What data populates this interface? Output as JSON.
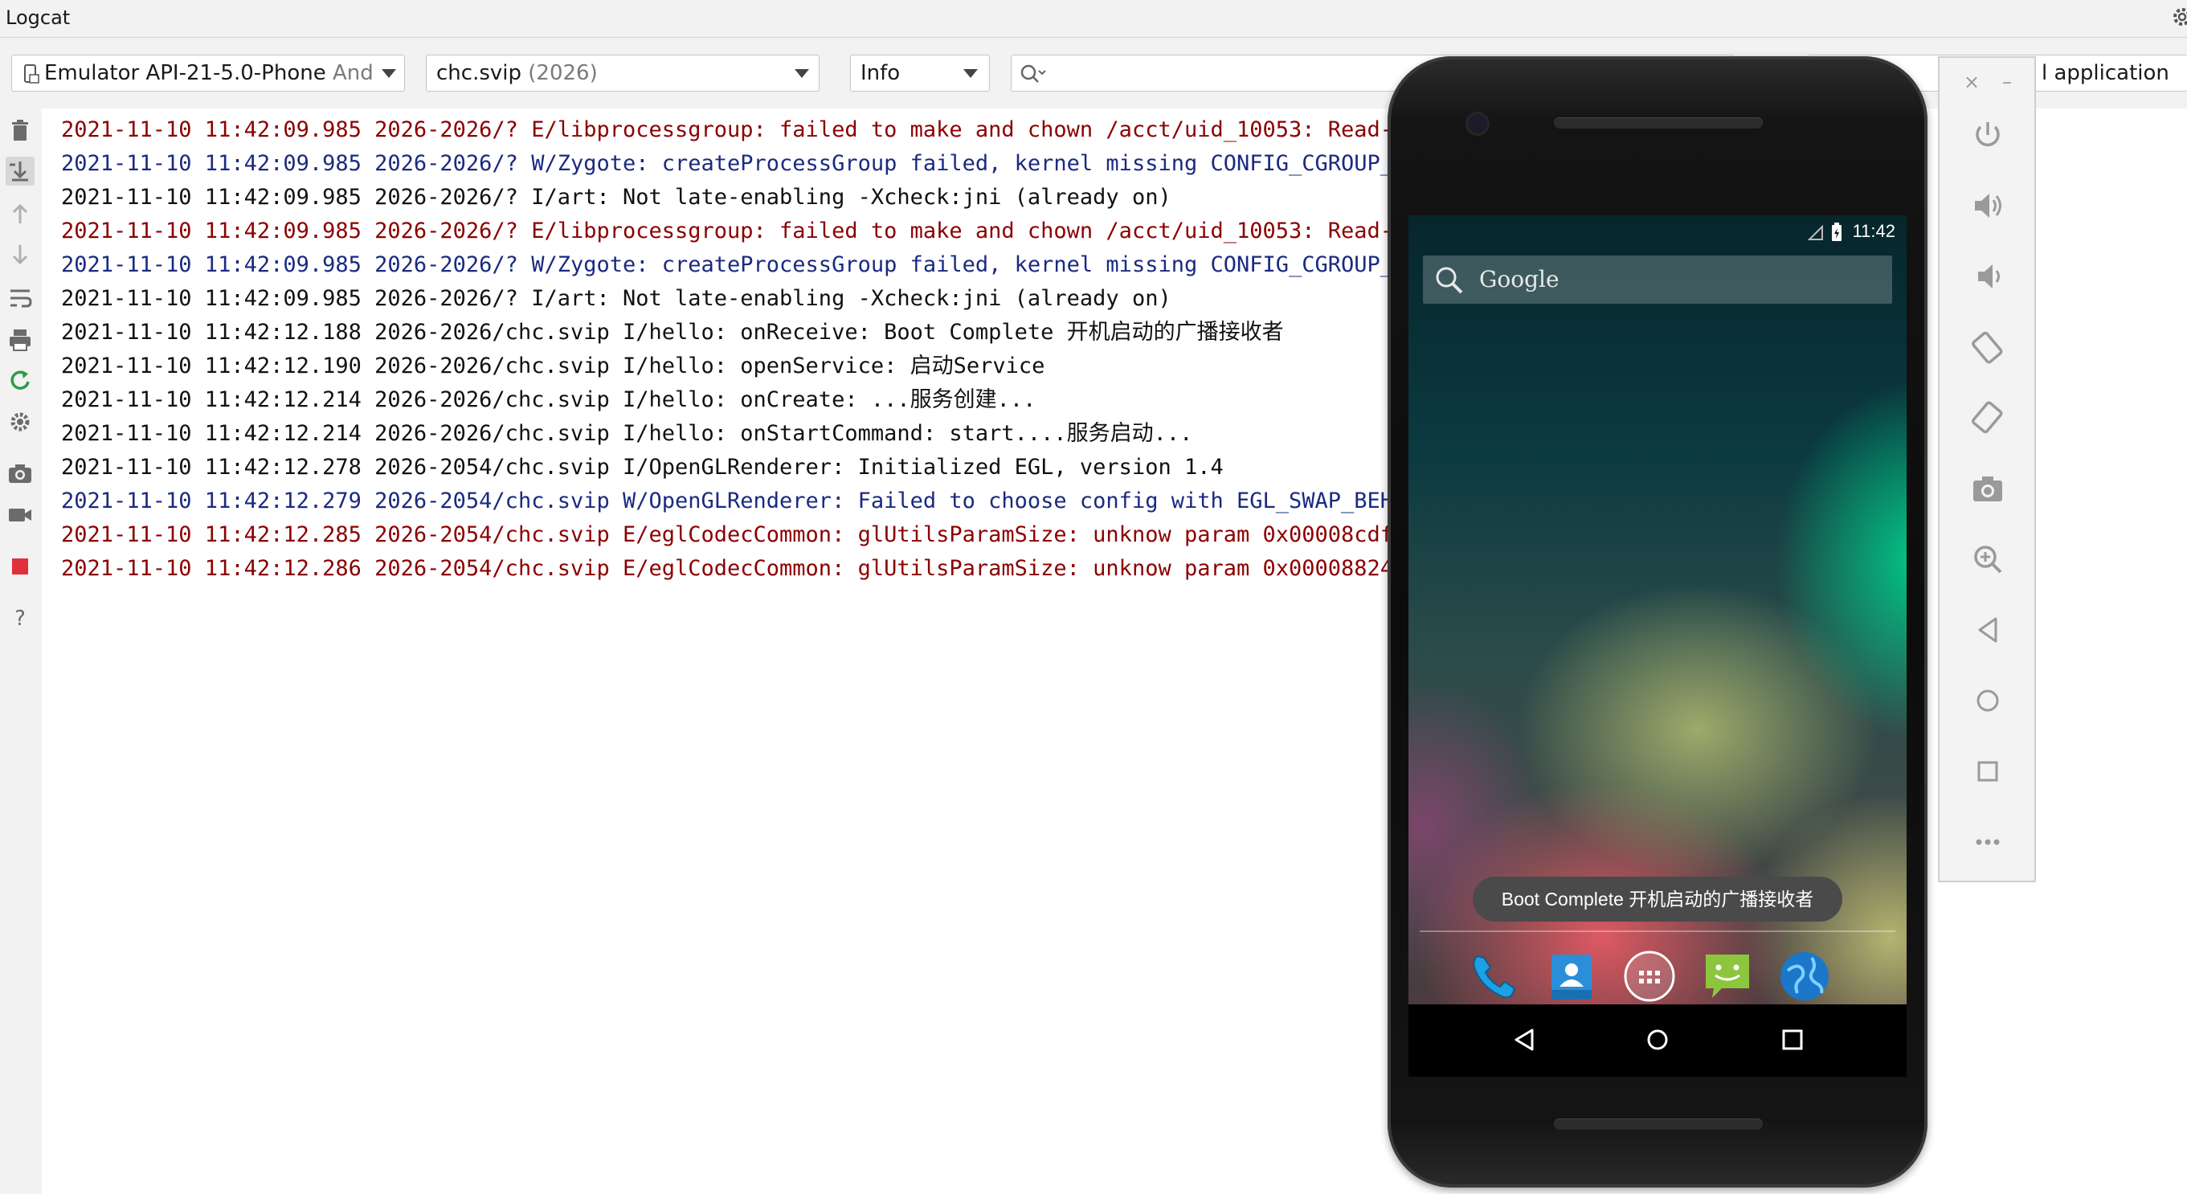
{
  "window": {
    "title": "Logcat"
  },
  "toolbar": {
    "device_label": "Emulator API-21-5.0-Phone",
    "device_suffix": "And",
    "process_name": "chc.svip",
    "process_pid": "(2026)",
    "level": "Info",
    "search_placeholder": "",
    "filter_partial": "on",
    "filter_label": "l application"
  },
  "colors": {
    "error": "#8b0000",
    "warning": "#1a2a80",
    "info": "#111111"
  },
  "log": [
    {
      "level": "E",
      "text": "2021-11-10 11:42:09.985 2026-2026/? E/libprocessgroup: failed to make and chown /acct/uid_10053: Read-o"
    },
    {
      "level": "W",
      "text": "2021-11-10 11:42:09.985 2026-2026/? W/Zygote: createProcessGroup failed, kernel missing CONFIG_CGROUP_C"
    },
    {
      "level": "I",
      "text": "2021-11-10 11:42:09.985 2026-2026/? I/art: Not late-enabling -Xcheck:jni (already on)"
    },
    {
      "level": "E",
      "text": "2021-11-10 11:42:09.985 2026-2026/? E/libprocessgroup: failed to make and chown /acct/uid_10053: Read-o"
    },
    {
      "level": "W",
      "text": "2021-11-10 11:42:09.985 2026-2026/? W/Zygote: createProcessGroup failed, kernel missing CONFIG_CGROUP_C"
    },
    {
      "level": "I",
      "text": "2021-11-10 11:42:09.985 2026-2026/? I/art: Not late-enabling -Xcheck:jni (already on)"
    },
    {
      "level": "I",
      "text": "2021-11-10 11:42:12.188 2026-2026/chc.svip I/hello: onReceive: Boot Complete 开机启动的广播接收者"
    },
    {
      "level": "I",
      "text": "2021-11-10 11:42:12.190 2026-2026/chc.svip I/hello: openService: 启动Service"
    },
    {
      "level": "I",
      "text": "2021-11-10 11:42:12.214 2026-2026/chc.svip I/hello: onCreate: ...服务创建..."
    },
    {
      "level": "I",
      "text": "2021-11-10 11:42:12.214 2026-2026/chc.svip I/hello: onStartCommand: start....服务启动..."
    },
    {
      "level": "I",
      "text": "2021-11-10 11:42:12.278 2026-2054/chc.svip I/OpenGLRenderer: Initialized EGL, version 1.4"
    },
    {
      "level": "W",
      "text": "2021-11-10 11:42:12.279 2026-2054/chc.svip W/OpenGLRenderer: Failed to choose config with EGL_SWAP_BEHA"
    },
    {
      "level": "E",
      "text": "2021-11-10 11:42:12.285 2026-2054/chc.svip E/eglCodecCommon: glUtilsParamSize: unknow param 0x00008cdf"
    },
    {
      "level": "E",
      "text": "2021-11-10 11:42:12.286 2026-2054/chc.svip E/eglCodecCommon: glUtilsParamSize: unknow param 0x00008824"
    }
  ],
  "sidebar_icons": [
    "trash-icon",
    "scroll-to-end-icon",
    "up-arrow-icon",
    "down-arrow-icon",
    "soft-wrap-icon",
    "print-icon",
    "restart-icon",
    "settings-icon",
    "screenshot-icon",
    "screen-record-icon",
    "stop-icon",
    "help-icon"
  ],
  "emulator": {
    "status_time": "11:42",
    "search_brand": "Google",
    "toast": "Boot Complete 开机启动的广播接收者",
    "dock_apps": [
      "phone-app-icon",
      "contacts-app-icon",
      "all-apps-icon",
      "messaging-app-icon",
      "browser-app-icon"
    ]
  },
  "emulator_panel": {
    "buttons": [
      "power-icon",
      "volume-up-icon",
      "volume-down-icon",
      "rotate-left-icon",
      "rotate-right-icon",
      "camera-icon",
      "zoom-icon",
      "back-icon",
      "home-icon",
      "overview-icon",
      "more-icon"
    ],
    "close_glyph": "×",
    "minimize_glyph": "–"
  }
}
